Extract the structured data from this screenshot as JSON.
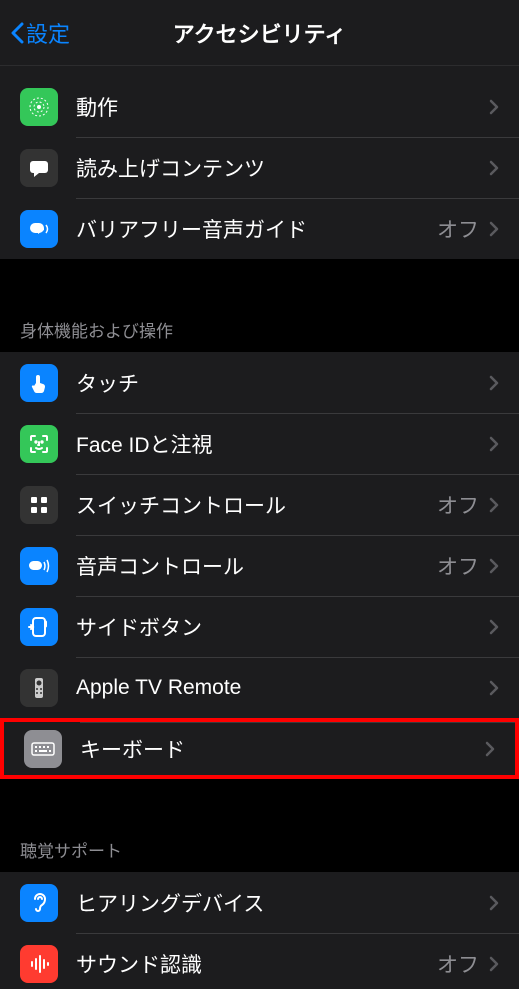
{
  "header": {
    "back_label": "設定",
    "title": "アクセシビリティ"
  },
  "value_off": "オフ",
  "groups": [
    {
      "header": null,
      "items": [
        {
          "id": "motion",
          "label": "動作",
          "value": null,
          "icon": "motion-icon",
          "icon_bg": "#34c759"
        },
        {
          "id": "spoken-content",
          "label": "読み上げコンテンツ",
          "value": null,
          "icon": "speech-bubble-icon",
          "icon_bg": "#333333"
        },
        {
          "id": "audio-descriptions",
          "label": "バリアフリー音声ガイド",
          "value": "オフ",
          "icon": "audio-desc-icon",
          "icon_bg": "#0a84ff"
        }
      ]
    },
    {
      "header": "身体機能および操作",
      "items": [
        {
          "id": "touch",
          "label": "タッチ",
          "value": null,
          "icon": "touch-icon",
          "icon_bg": "#0a84ff"
        },
        {
          "id": "faceid-attention",
          "label": "Face IDと注視",
          "value": null,
          "icon": "faceid-icon",
          "icon_bg": "#34c759"
        },
        {
          "id": "switch-control",
          "label": "スイッチコントロール",
          "value": "オフ",
          "icon": "switch-icon",
          "icon_bg": "#333333"
        },
        {
          "id": "voice-control",
          "label": "音声コントロール",
          "value": "オフ",
          "icon": "voice-control-icon",
          "icon_bg": "#0a84ff"
        },
        {
          "id": "side-button",
          "label": "サイドボタン",
          "value": null,
          "icon": "side-button-icon",
          "icon_bg": "#0a84ff"
        },
        {
          "id": "apple-tv-remote",
          "label": "Apple TV Remote",
          "value": null,
          "icon": "remote-icon",
          "icon_bg": "#333333"
        },
        {
          "id": "keyboard",
          "label": "キーボード",
          "value": null,
          "icon": "keyboard-icon",
          "icon_bg": "#8e8e93",
          "highlight": true
        }
      ]
    },
    {
      "header": "聴覚サポート",
      "items": [
        {
          "id": "hearing-devices",
          "label": "ヒアリングデバイス",
          "value": null,
          "icon": "ear-icon",
          "icon_bg": "#0a84ff"
        },
        {
          "id": "sound-recognition",
          "label": "サウンド認識",
          "value": "オフ",
          "icon": "sound-rec-icon",
          "icon_bg": "#ff3b30"
        }
      ]
    }
  ]
}
